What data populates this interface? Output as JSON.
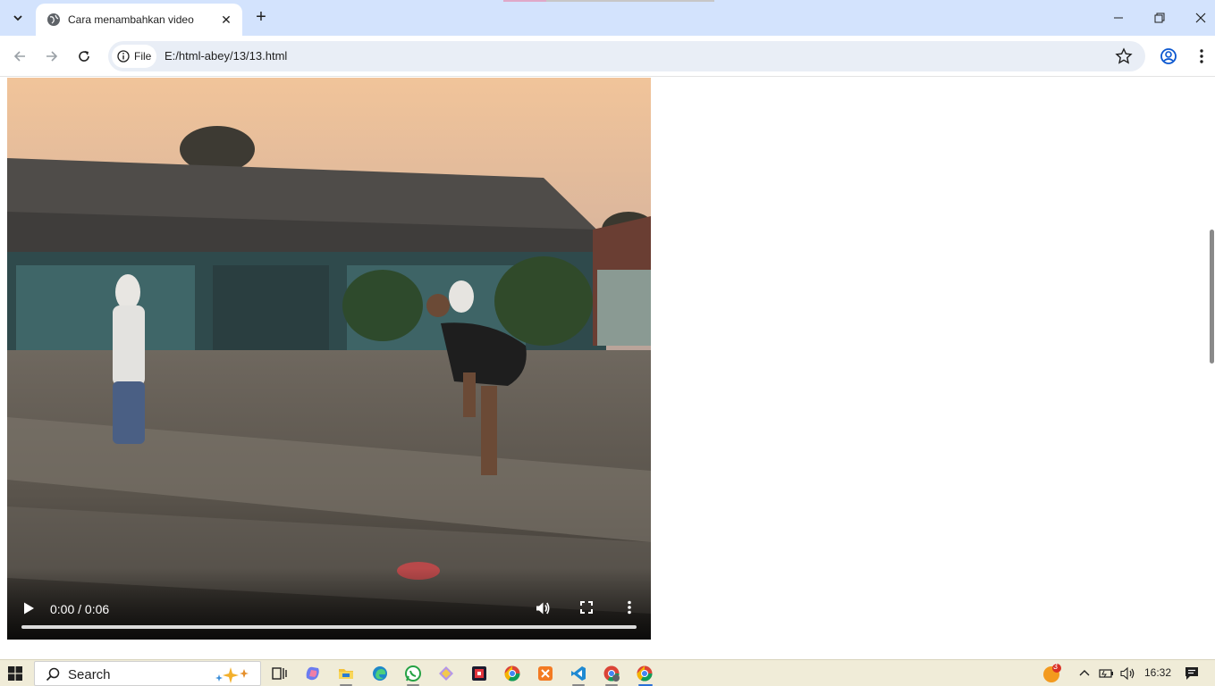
{
  "browser": {
    "tab_title": "Cara menambahkan video",
    "omnibox_chip_label": "File",
    "url": "E:/html-abey/13/13.html",
    "colors": {
      "tabstrip": "#d3e3fd",
      "omnibox": "#e9eef6"
    }
  },
  "video": {
    "time_display": "0:00 / 0:06",
    "progress": 0,
    "icons": [
      "play-icon",
      "volume-icon",
      "fullscreen-icon",
      "more-options-icon"
    ]
  },
  "taskbar": {
    "search_label": "Search",
    "clock": "16:32",
    "notification_count": "3",
    "apps": [
      "task-view",
      "copilot",
      "file-explorer",
      "edge",
      "whatsapp",
      "app-diamond",
      "app-red-square",
      "chrome",
      "xampp",
      "vscode",
      "chrome-profile",
      "chrome-active"
    ]
  }
}
